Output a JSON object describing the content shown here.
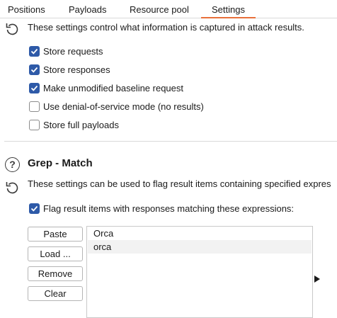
{
  "tabs": [
    {
      "label": "Positions",
      "active": false
    },
    {
      "label": "Payloads",
      "active": false
    },
    {
      "label": "Resource pool",
      "active": false
    },
    {
      "label": "Settings",
      "active": true
    }
  ],
  "results_section": {
    "description": "These settings control what information is captured in attack results.",
    "options": [
      {
        "label": "Store requests",
        "checked": true
      },
      {
        "label": "Store responses",
        "checked": true
      },
      {
        "label": "Make unmodified baseline request",
        "checked": true
      },
      {
        "label": "Use denial-of-service mode (no results)",
        "checked": false
      },
      {
        "label": "Store full payloads",
        "checked": false
      }
    ]
  },
  "grep_match": {
    "title": "Grep - Match",
    "description": "These settings can be used to flag result items containing specified expres",
    "flag_option": {
      "label": "Flag result items with responses matching these expressions:",
      "checked": true
    },
    "buttons": {
      "paste": "Paste",
      "load": "Load ...",
      "remove": "Remove",
      "clear": "Clear"
    },
    "expressions": [
      "Orca",
      "orca"
    ]
  },
  "icons": {
    "reset": "reset-icon",
    "help": "help-icon",
    "help_glyph": "?",
    "expand": "expand-arrow-icon"
  },
  "colors": {
    "accent": "#e8703a",
    "checkbox_checked": "#2e5aa8"
  }
}
